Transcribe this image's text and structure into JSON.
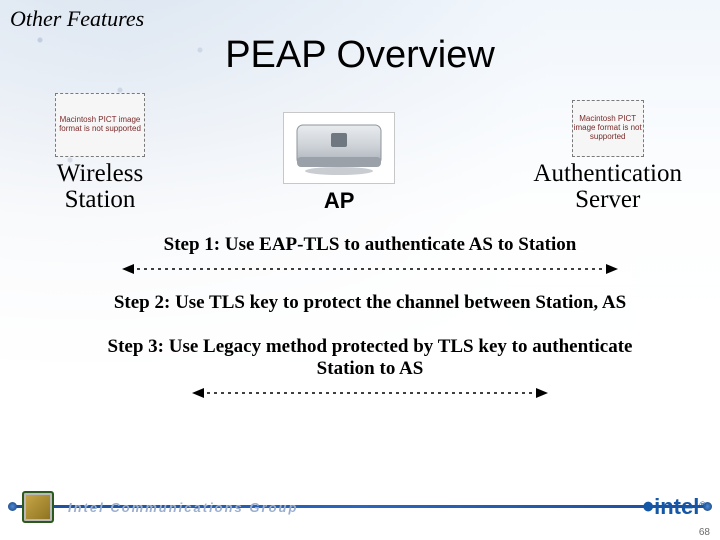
{
  "section_label": "Other Features",
  "title": "PEAP Overview",
  "placeholders": {
    "pict_text": "Macintosh PICT image format is not supported"
  },
  "nodes": {
    "station": "Wireless\nStation",
    "ap": "AP",
    "as": "Authentication\nServer"
  },
  "steps": [
    "Step 1: Use EAP-TLS to authenticate AS to Station",
    "Step 2: Use TLS key to protect the channel between Station, AS",
    "Step 3: Use Legacy method protected by TLS key to authenticate Station to AS"
  ],
  "footer": {
    "group_text": "Intel Communications Group",
    "brand": "intel",
    "reg": "®"
  },
  "page_number": "68"
}
